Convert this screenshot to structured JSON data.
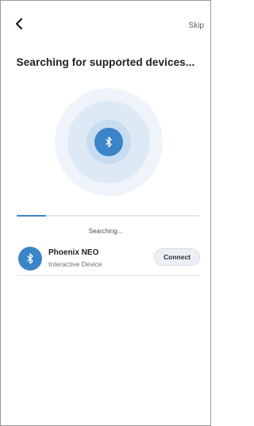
{
  "header": {
    "back_icon": "chevron-left-icon",
    "skip_label": "Skip"
  },
  "title": "Searching for supported devices...",
  "radar": {
    "icon": "bluetooth-icon",
    "accent_color": "#3b84c8"
  },
  "progress": {
    "value": 0.16,
    "status_text": "Searching..."
  },
  "devices": [
    {
      "icon": "bluetooth-icon",
      "name": "Phoenix NEO",
      "type": "Interactive Device",
      "action_label": "Connect"
    }
  ]
}
